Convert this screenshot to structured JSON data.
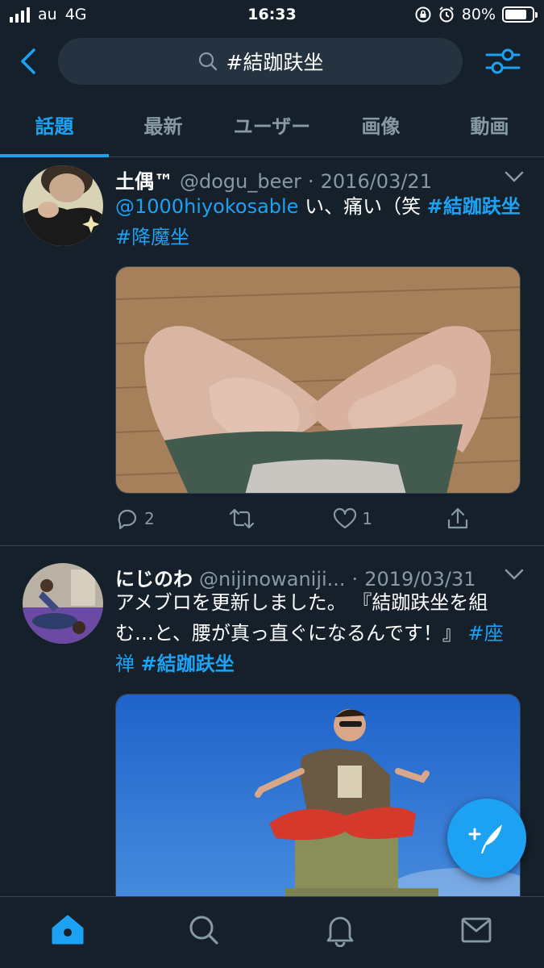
{
  "status_bar": {
    "carrier": "au",
    "network": "4G",
    "time": "16:33",
    "battery": "80%",
    "battery_level": 0.8
  },
  "search": {
    "query": "#結跏趺坐"
  },
  "tabs": [
    {
      "label": "話題",
      "active": true
    },
    {
      "label": "最新",
      "active": false
    },
    {
      "label": "ユーザー",
      "active": false
    },
    {
      "label": "画像",
      "active": false
    },
    {
      "label": "動画",
      "active": false
    }
  ],
  "tweets": [
    {
      "name": "土偶™",
      "handle": "@dogu_beer",
      "separator": "·",
      "date": "2016/03/21",
      "mention": "@1000hiyokosable",
      "text": " い、痛い（笑 ",
      "hashtag1": "#結跏趺坐",
      "hashtag2": "#降魔坐",
      "replies": "2",
      "retweets": "",
      "likes": "1"
    },
    {
      "name": "にじのわ",
      "handle": "@nijinowaniji...",
      "separator": "·",
      "date": "2019/03/31",
      "text": "アメブロを更新しました。 『結跏趺坐を組む…と、腰が真っ直ぐになるんです！』 ",
      "hashtag1": "#座禅",
      "hashtag2": "#結跏趺坐"
    }
  ],
  "colors": {
    "background": "#15202b",
    "accent": "#1da1f2",
    "secondary_text": "#8899a6",
    "divider": "#38444d"
  }
}
